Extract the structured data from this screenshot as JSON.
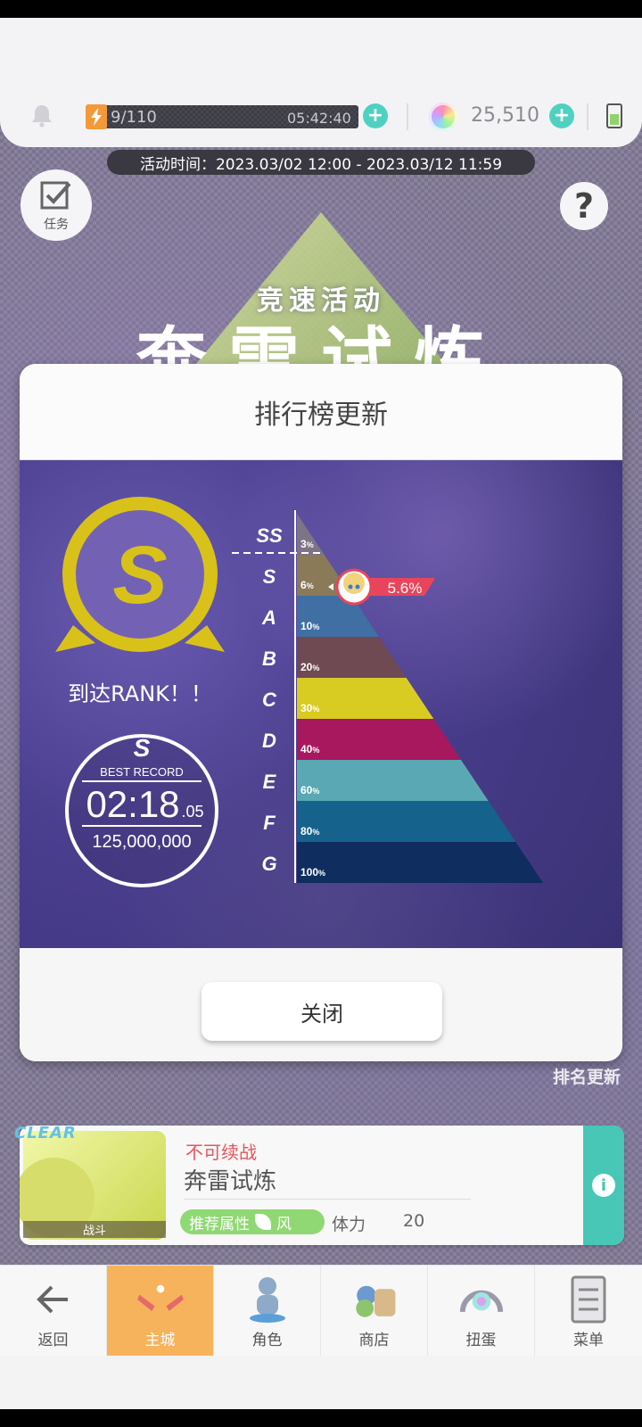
{
  "header": {
    "stamina_count": "9/110",
    "stamina_timer": "05:42:40",
    "gem_count": "25,510"
  },
  "event": {
    "time": "活动时间：2023.03/02 12:00 - 2023.03/12 11:59",
    "subtitle": "竞速活动",
    "title": "奔雷试炼"
  },
  "side_buttons": {
    "task_label": "任务",
    "help_label": "?"
  },
  "modal": {
    "title": "排行榜更新",
    "rank_reached": "到达RANK！！",
    "badge_letter": "S",
    "record": {
      "rank": "S",
      "label": "BEST RECORD",
      "time_main": "02:18",
      "time_fraction": ".05",
      "score": "125,000,000"
    },
    "player_percent": "5.6%",
    "close_label": "关闭"
  },
  "ranking_tiers": [
    {
      "rank": "SS",
      "pct": "3",
      "pct_unit": "%",
      "color": "#7d7486"
    },
    {
      "rank": "S",
      "pct": "6",
      "pct_unit": "%",
      "color": "#8a7a58"
    },
    {
      "rank": "A",
      "pct": "10",
      "pct_unit": "%",
      "color": "#3f6fa3"
    },
    {
      "rank": "B",
      "pct": "20",
      "pct_unit": "%",
      "color": "#6f4a52"
    },
    {
      "rank": "C",
      "pct": "30",
      "pct_unit": "%",
      "color": "#d8cc23"
    },
    {
      "rank": "D",
      "pct": "40",
      "pct_unit": "%",
      "color": "#a8185e"
    },
    {
      "rank": "E",
      "pct": "60",
      "pct_unit": "%",
      "color": "#5aa8b4"
    },
    {
      "rank": "F",
      "pct": "80",
      "pct_unit": "%",
      "color": "#15628c"
    },
    {
      "rank": "G",
      "pct": "100",
      "pct_unit": "%",
      "color": "#0f2d5e"
    }
  ],
  "ranking_update_label": "排名更新",
  "quest": {
    "clear_tag": "CLEAR",
    "thumb_label": "战斗",
    "status": "不可续战",
    "name": "奔雷试炼",
    "attr_label": "推荐属性",
    "attr_value": "风",
    "stamina_label": "体力",
    "stamina_value": "20"
  },
  "nav": [
    {
      "label": "返回",
      "icon": "back-arrow-icon"
    },
    {
      "label": "主城",
      "icon": "castle-icon"
    },
    {
      "label": "角色",
      "icon": "character-icon"
    },
    {
      "label": "商店",
      "icon": "shop-icon"
    },
    {
      "label": "扭蛋",
      "icon": "gacha-icon"
    },
    {
      "label": "菜单",
      "icon": "menu-icon"
    }
  ],
  "colors": {
    "accent_teal": "#4fd1c1",
    "rank_gold": "#d8c21a",
    "marker_red": "#e8455c",
    "nav_active": "#f6b35c"
  }
}
